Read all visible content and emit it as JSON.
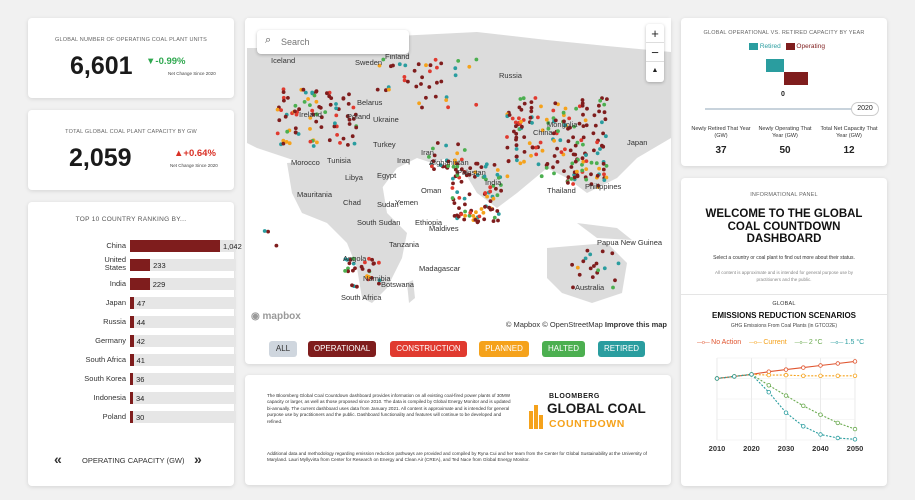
{
  "kpi1": {
    "label": "GLOBAL NUMBER OF OPERATING COAL PLANT UNITS",
    "value": "6,601",
    "change": "-0.99%",
    "sub": "Net Change Since 2020",
    "color": "#2fa84f"
  },
  "kpi2": {
    "label": "TOTAL GLOBAL COAL PLANT CAPACITY BY GW",
    "value": "2,059",
    "change": "+0.64%",
    "sub": "Net Change Since 2020",
    "color": "#d93025"
  },
  "ranking": {
    "title": "TOP 10 COUNTRY RANKING BY...",
    "metric": "OPERATING CAPACITY (GW)",
    "prev_icon": "double-chevron-left-icon",
    "next_icon": "double-chevron-right-icon",
    "rows": [
      {
        "name": "China",
        "value": 1042
      },
      {
        "name": "United States",
        "value": 233
      },
      {
        "name": "India",
        "value": 229
      },
      {
        "name": "Japan",
        "value": 47
      },
      {
        "name": "Russia",
        "value": 44
      },
      {
        "name": "Germany",
        "value": 42
      },
      {
        "name": "South Africa",
        "value": 41
      },
      {
        "name": "South Korea",
        "value": 36
      },
      {
        "name": "Indonesia",
        "value": 34
      },
      {
        "name": "Poland",
        "value": 30
      }
    ],
    "max": 1042,
    "bar_color": "#7f1d1d"
  },
  "map": {
    "search_placeholder": "Search",
    "zoom_in": "+",
    "zoom_out": "−",
    "compass": "▲",
    "attribution_mapbox": "© Mapbox",
    "attribution_osm": "© OpenStreetMap",
    "improve": "Improve this map",
    "logo": "mapbox",
    "labels": [
      "Iceland",
      "Sweden",
      "Finland",
      "Russia",
      "Poland",
      "Belarus",
      "Ukraine",
      "Turkey",
      "Iraq",
      "Iran",
      "Afghanistan",
      "Pakistan",
      "India",
      "China",
      "Mongolia",
      "Japan",
      "Tunisia",
      "Libya",
      "Egypt",
      "Morocco",
      "Mauritania",
      "Chad",
      "Sudan",
      "South Sudan",
      "Yemen",
      "Oman",
      "Maldives",
      "Tanzania",
      "Angola",
      "Namibia",
      "Botswana",
      "South Africa",
      "Madagascar",
      "Thailand",
      "Philippines",
      "Papua New Guinea",
      "Australia",
      "Ireland",
      "Ethiopia"
    ]
  },
  "filters": [
    {
      "label": "ALL",
      "color": "#cfd6de",
      "text": "#333"
    },
    {
      "label": "OPERATIONAL",
      "color": "#7f1d1d",
      "text": "#fff"
    },
    {
      "label": "CONSTRUCTION",
      "color": "#e03a2f",
      "text": "#fff"
    },
    {
      "label": "PLANNED",
      "color": "#f5a21b",
      "text": "#fff"
    },
    {
      "label": "HALTED",
      "color": "#4caf50",
      "text": "#fff"
    },
    {
      "label": "RETIRED",
      "color": "#2a9d9f",
      "text": "#fff"
    }
  ],
  "info": {
    "para1": "The Bloomberg Global Coal Countdown dashboard provides information on all existing coal-fired power plants of 30MW capacity or larger, as well as those proposed since 2010. The data is compiled by Global Energy Monitor and is updated bi-annually. The current dashboard uses data from January 2021. All content is approximate and is intended for general purpose use by practitioners and the public. Dashboard functionality and features will continue to be developed and refined.",
    "para2": "Additional data and methodology regarding emission reduction pathways are provided and compiled by Ryna Cui and her team from the Center for Global Sustainability at the University of Maryland. Lauri Myllyvirta from Center for Research on Energy and Clean Air (CREA), and Ted Nace from Global Energy Monitor.",
    "logo_line1": "BLOOMBERG",
    "logo_line2": "GLOBAL COAL",
    "logo_line3": "COUNTDOWN"
  },
  "capacity": {
    "title": "GLOBAL OPERATIONAL VS. RETIRED CAPACITY BY YEAR",
    "legend_retired": "Retired",
    "legend_operating": "Operating",
    "retired_color": "#2a9d9f",
    "operating_color": "#7f1d1d",
    "zero_label": "0",
    "year": "2020",
    "stats": [
      {
        "label": "Newly Retired That Year (GW)",
        "value": "37"
      },
      {
        "label": "Newly Operating That Year (GW)",
        "value": "50"
      },
      {
        "label": "Total Net Capacity That Year (GW)",
        "value": "12"
      }
    ]
  },
  "panel": {
    "caption": "INFORMATIONAL PANEL",
    "title": "WELCOME TO THE GLOBAL COAL COUNTDOWN DASHBOARD",
    "prompt": "Select a country or coal plant to find out more about their status.",
    "note": "All content is approximate and is intended for general purpose use by practitioners and the public."
  },
  "scenarios": {
    "caption": "GLOBAL",
    "title": "EMISSIONS REDUCTION SCENARIOS",
    "subtitle": "GHG Emissions From Coal Plants (in GTCO2E)"
  },
  "chart_data": {
    "type": "line",
    "title": "EMISSIONS REDUCTION SCENARIOS",
    "subtitle": "GHG Emissions From Coal Plants (in GTCO2E)",
    "x": [
      2010,
      2015,
      2020,
      2025,
      2030,
      2035,
      2040,
      2045,
      2050
    ],
    "xticks": [
      2010,
      2020,
      2030,
      2040,
      2050
    ],
    "ylim": [
      0,
      12
    ],
    "grid": true,
    "series": [
      {
        "name": "No Action",
        "color": "#e0552f",
        "dash": false,
        "values": [
          9.0,
          9.3,
          9.6,
          10.0,
          10.3,
          10.6,
          10.9,
          11.2,
          11.5
        ]
      },
      {
        "name": "Current",
        "color": "#f5a21b",
        "dash": true,
        "values": [
          9.0,
          9.3,
          9.6,
          9.5,
          9.5,
          9.4,
          9.4,
          9.4,
          9.4
        ]
      },
      {
        "name": "2 °C",
        "color": "#6aaa4f",
        "dash": true,
        "values": [
          9.0,
          9.3,
          9.6,
          8.0,
          6.5,
          5.0,
          3.7,
          2.5,
          1.6
        ]
      },
      {
        "name": "1.5 °C",
        "color": "#2a9d9f",
        "dash": true,
        "values": [
          9.0,
          9.3,
          9.6,
          7.0,
          4.0,
          2.0,
          0.8,
          0.3,
          0.1
        ]
      }
    ]
  }
}
